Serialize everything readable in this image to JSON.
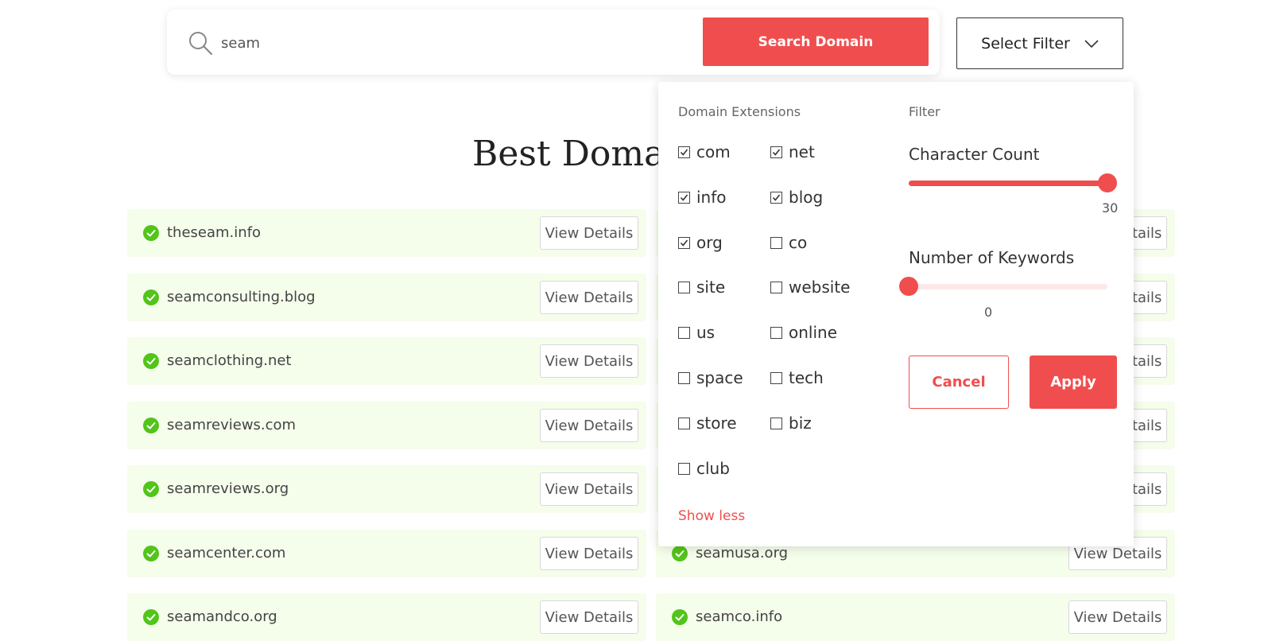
{
  "search": {
    "value": "seam",
    "placeholder": "",
    "button_label": "Search Domain"
  },
  "filter_button": {
    "label": "Select Filter"
  },
  "results": {
    "title": "Best Domain",
    "view_label": "View Details",
    "left": [
      {
        "domain": "theseam.info"
      },
      {
        "domain": "seamconsulting.blog"
      },
      {
        "domain": "seamclothing.net"
      },
      {
        "domain": "seamreviews.com"
      },
      {
        "domain": "seamreviews.org"
      },
      {
        "domain": "seamcenter.com"
      },
      {
        "domain": "seamandco.org"
      }
    ],
    "right": [
      {
        "domain": ""
      },
      {
        "domain": ""
      },
      {
        "domain": ""
      },
      {
        "domain": ""
      },
      {
        "domain": ""
      },
      {
        "domain": "seamusa.org"
      },
      {
        "domain": "seamco.info"
      }
    ]
  },
  "filter_panel": {
    "extensions_heading": "Domain Extensions",
    "filter_heading": "Filter",
    "extensions": [
      {
        "label": "com",
        "checked": true
      },
      {
        "label": "net",
        "checked": true
      },
      {
        "label": "info",
        "checked": true
      },
      {
        "label": "blog",
        "checked": true
      },
      {
        "label": "org",
        "checked": true
      },
      {
        "label": "co",
        "checked": false
      },
      {
        "label": "site",
        "checked": false
      },
      {
        "label": "website",
        "checked": false
      },
      {
        "label": "us",
        "checked": false
      },
      {
        "label": "online",
        "checked": false
      },
      {
        "label": "space",
        "checked": false
      },
      {
        "label": "tech",
        "checked": false
      },
      {
        "label": "store",
        "checked": false
      },
      {
        "label": "biz",
        "checked": false
      },
      {
        "label": "club",
        "checked": false
      }
    ],
    "show_less_label": "Show less",
    "character_count": {
      "label": "Character Count",
      "value": "30",
      "level": 1.0
    },
    "keywords": {
      "label": "Number of Keywords",
      "value": "0",
      "level": 0.0
    },
    "cancel_label": "Cancel",
    "apply_label": "Apply"
  },
  "colors": {
    "accent": "#f04e4e",
    "row_bg": "#f5fdeb",
    "check_green": "#52c41a",
    "track_empty": "#fde8e8"
  }
}
